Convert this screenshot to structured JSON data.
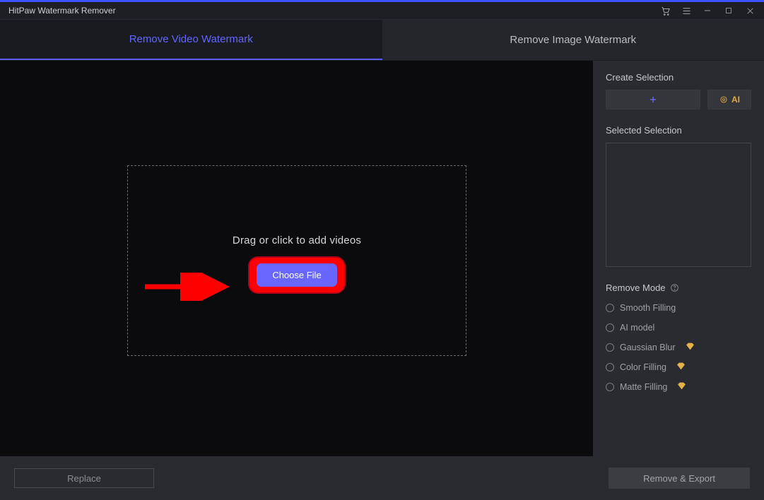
{
  "titlebar": {
    "title": "HitPaw Watermark Remover"
  },
  "tabs": {
    "video": "Remove Video Watermark",
    "image": "Remove Image Watermark"
  },
  "dropzone": {
    "hint": "Drag or click to add videos",
    "choose": "Choose File"
  },
  "sidebar": {
    "create_label": "Create Selection",
    "ai_label": "AI",
    "selected_label": "Selected Selection",
    "mode_label": "Remove Mode",
    "modes": [
      "Smooth Filling",
      "AI model",
      "Gaussian Blur",
      "Color Filling",
      "Matte Filling"
    ]
  },
  "bottom": {
    "replace": "Replace",
    "export": "Remove & Export"
  }
}
